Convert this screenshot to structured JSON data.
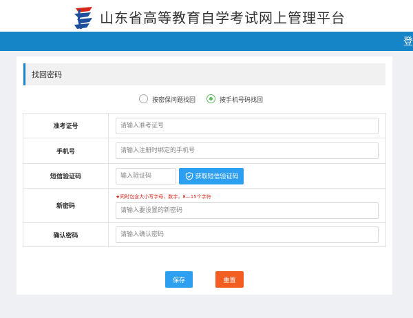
{
  "header": {
    "site_title": "山东省高等教育自学考试网上管理平台",
    "login_label": "登"
  },
  "section": {
    "title": "找回密码"
  },
  "recovery_options": [
    {
      "label": "按密保问题找回",
      "checked": false
    },
    {
      "label": "按手机号码找回",
      "checked": true
    }
  ],
  "form": {
    "exam_id": {
      "label": "准考证号",
      "placeholder": "请输入准考证号"
    },
    "phone": {
      "label": "手机号",
      "placeholder": "请输入注册时绑定的手机号"
    },
    "sms_code": {
      "label": "短信验证码",
      "placeholder": "输入验证码",
      "button_label": "获取短信验证码"
    },
    "new_password": {
      "label": "新密码",
      "hint": "★同时包含大小写字母、数字，8—15个字符",
      "placeholder": "请输入要设置的新密码"
    },
    "confirm_password": {
      "label": "确认密码",
      "placeholder": "请输入确认密码"
    }
  },
  "actions": {
    "save_label": "保存",
    "reset_label": "重置"
  },
  "colors": {
    "brand_blue": "#1685c7",
    "button_blue": "#2d9ff0",
    "reset_orange": "#f25d22",
    "radio_green": "#5cb85c",
    "hint_red": "#d8281e"
  },
  "icons": {
    "logo": "exam-authority-logo",
    "sms_button": "shield-check-icon"
  }
}
